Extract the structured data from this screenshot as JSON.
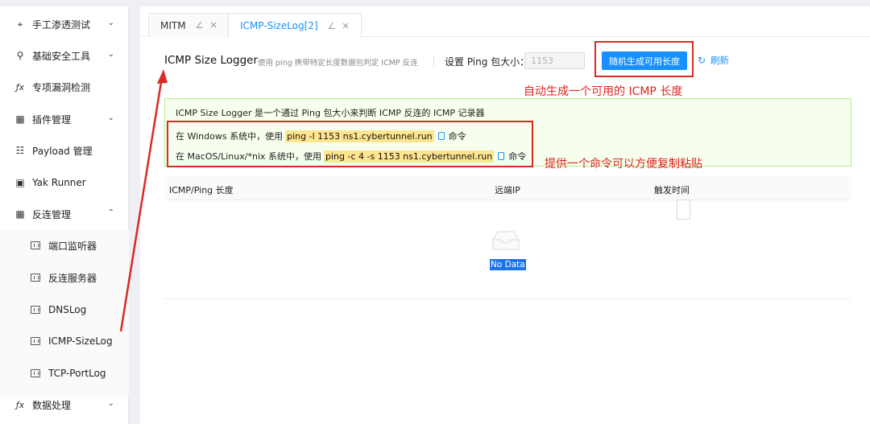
{
  "sidebar": {
    "items": [
      {
        "label": "手工渗透测试",
        "icon": "target-icon",
        "glyph": "⌖",
        "chevron": "⌄"
      },
      {
        "label": "基础安全工具",
        "icon": "tool-icon",
        "glyph": "⚲",
        "chevron": "⌄"
      },
      {
        "label": "专项漏洞检测",
        "icon": "function-icon",
        "glyph": "ƒx"
      },
      {
        "label": "插件管理",
        "icon": "grid-icon",
        "glyph": "▦",
        "chevron": "⌄"
      },
      {
        "label": "Payload 管理",
        "icon": "payload-icon",
        "glyph": "☷"
      },
      {
        "label": "Yak Runner",
        "icon": "terminal-icon",
        "glyph": "▣"
      },
      {
        "label": "反连管理",
        "icon": "grid-icon",
        "glyph": "▦",
        "chevron": "⌃"
      }
    ],
    "subitems": [
      {
        "label": "端口监听器"
      },
      {
        "label": "反连服务器"
      },
      {
        "label": "DNSLog"
      },
      {
        "label": "ICMP-SizeLog"
      },
      {
        "label": "TCP-PortLog"
      }
    ],
    "last": {
      "label": "数据处理",
      "icon": "function-icon",
      "glyph": "ƒx",
      "chevron": "⌄"
    }
  },
  "tabs": [
    {
      "label": "MITM",
      "active": false
    },
    {
      "label": "ICMP-SizeLog[2]",
      "active": true
    }
  ],
  "tab_edit_glyph": "∠",
  "tab_close_glyph": "✕",
  "header": {
    "title": "ICMP Size Logger",
    "description": "使用 ping 携带特定长度数据包判定 ICMP 反连",
    "ping_size_label": "设置 Ping 包大小：",
    "ping_size_value": "1153",
    "generate_button": "随机生成可用长度",
    "refresh_label": "刷新",
    "refresh_glyph": "↻"
  },
  "annotations": {
    "generate": "自动生成一个可用的 ICMP 长度",
    "command": "提供一个命令可以方便复制粘贴"
  },
  "info": {
    "title": "ICMP Size Logger 是一个通过 Ping 包大小来判断 ICMP 反连的 ICMP 记录器",
    "windows_prefix": "在 Windows 系统中，使用",
    "windows_cmd": "ping -l 1153 ns1.cybertunnel.run",
    "windows_suffix": "命令",
    "mac_prefix": "在 MacOS/Linux/*nix 系统中，使用",
    "mac_cmd": "ping -c 4 -s 1153 ns1.cybertunnel.run",
    "mac_suffix": "命令"
  },
  "table": {
    "columns": [
      "ICMP/Ping 长度",
      "远端IP",
      "触发时间"
    ],
    "empty_text": "No Data"
  },
  "colors": {
    "accent": "#1890ff",
    "annotation_red": "#e0241f",
    "info_bg": "#f6ffed",
    "highlight": "#ffe58f"
  }
}
